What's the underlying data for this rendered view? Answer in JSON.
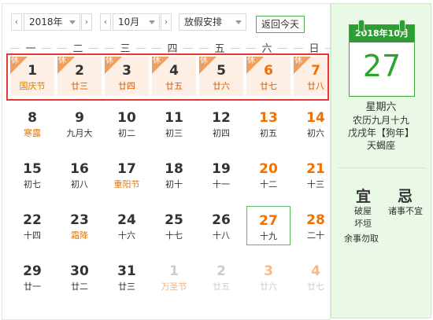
{
  "toolbar": {
    "year": "2018年",
    "month": "10月",
    "holiday": "放假安排",
    "today": "返回今天"
  },
  "weekdays": [
    "一",
    "二",
    "三",
    "四",
    "五",
    "六",
    "日"
  ],
  "holiday_tag": "休",
  "days": [
    {
      "num": "1",
      "lunar": "国庆节"
    },
    {
      "num": "2",
      "lunar": "廿三"
    },
    {
      "num": "3",
      "lunar": "廿四"
    },
    {
      "num": "4",
      "lunar": "廿五"
    },
    {
      "num": "5",
      "lunar": "廿六"
    },
    {
      "num": "6",
      "lunar": "廿七"
    },
    {
      "num": "7",
      "lunar": "廿八"
    },
    {
      "num": "8",
      "lunar": "寒露"
    },
    {
      "num": "9",
      "lunar": "九月大"
    },
    {
      "num": "10",
      "lunar": "初二"
    },
    {
      "num": "11",
      "lunar": "初三"
    },
    {
      "num": "12",
      "lunar": "初四"
    },
    {
      "num": "13",
      "lunar": "初五"
    },
    {
      "num": "14",
      "lunar": "初六"
    },
    {
      "num": "15",
      "lunar": "初七"
    },
    {
      "num": "16",
      "lunar": "初八"
    },
    {
      "num": "17",
      "lunar": "重阳节"
    },
    {
      "num": "18",
      "lunar": "初十"
    },
    {
      "num": "19",
      "lunar": "十一"
    },
    {
      "num": "20",
      "lunar": "十二"
    },
    {
      "num": "21",
      "lunar": "十三"
    },
    {
      "num": "22",
      "lunar": "十四"
    },
    {
      "num": "23",
      "lunar": "霜降"
    },
    {
      "num": "24",
      "lunar": "十六"
    },
    {
      "num": "25",
      "lunar": "十七"
    },
    {
      "num": "26",
      "lunar": "十八"
    },
    {
      "num": "27",
      "lunar": "十九"
    },
    {
      "num": "28",
      "lunar": "二十"
    },
    {
      "num": "29",
      "lunar": "廿一"
    },
    {
      "num": "30",
      "lunar": "廿二"
    },
    {
      "num": "31",
      "lunar": "廿三"
    },
    {
      "num": "1",
      "lunar": "万圣节"
    },
    {
      "num": "2",
      "lunar": "廿五"
    },
    {
      "num": "3",
      "lunar": "廿六"
    },
    {
      "num": "4",
      "lunar": "廿七"
    }
  ],
  "side": {
    "header": "2018年10月",
    "day": "27",
    "weekday": "星期六",
    "lunar": "农历九月十九",
    "ganzhi": "戊戌年【狗年】",
    "zodiac": "天蝎座",
    "yi_label": "宜",
    "ji_label": "忌",
    "yi_1": "破屋",
    "yi_2": "坏垣",
    "yi_3": "余事勿取",
    "ji_1": "诸事不宜"
  },
  "colors": {
    "accent_green": "#2e9e34",
    "weekend_orange": "#f07000",
    "holiday_bg": "#fdefe4",
    "highlight_red": "#e53935"
  }
}
